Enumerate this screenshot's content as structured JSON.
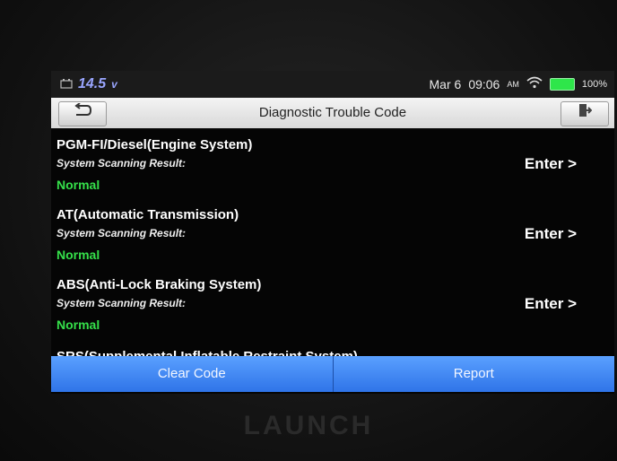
{
  "status_bar": {
    "voltage": "14.5",
    "voltage_unit": "v",
    "date": "Mar 6",
    "time": "09:06",
    "ampm": "AM",
    "battery": "100%",
    "icons": [
      "car-battery-icon",
      "wifi-icon",
      "battery-icon"
    ]
  },
  "title_bar": {
    "title": "Diagnostic Trouble Code",
    "back_icon": "back-arrow-icon",
    "exit_icon": "exit-icon"
  },
  "systems": [
    {
      "name": "PGM-FI/Diesel(Engine System)",
      "result_label": "System Scanning Result:",
      "status": "Normal",
      "action": "Enter >"
    },
    {
      "name": "AT(Automatic Transmission)",
      "result_label": "System Scanning Result:",
      "status": "Normal",
      "action": "Enter >"
    },
    {
      "name": "ABS(Anti-Lock Braking System)",
      "result_label": "System Scanning Result:",
      "status": "Normal",
      "action": "Enter >"
    }
  ],
  "partial_item": "SRS(Supplemental Inflatable Restraint System)",
  "bottom_buttons": {
    "clear": "Clear Code",
    "report": "Report"
  },
  "device_brand": "LAUNCH",
  "colors": {
    "status_normal": "#35e04a",
    "button_blue": "#3f86f3",
    "title_bar": "#e6e6e6"
  }
}
